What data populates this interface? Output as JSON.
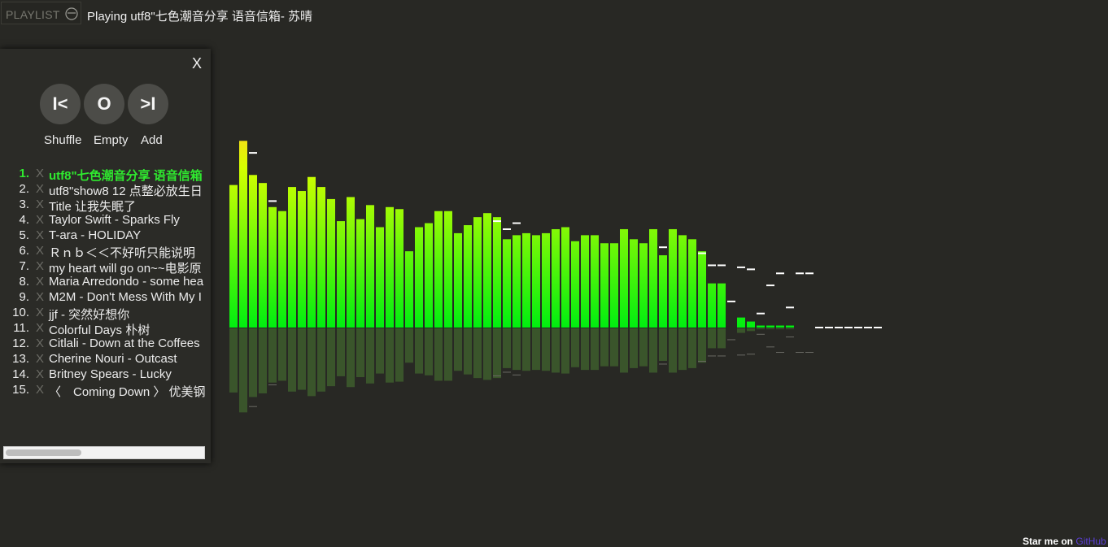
{
  "header": {
    "playlist_label": "PLAYLIST",
    "now_playing": "Playing utf8\"七色潮音分享 语音信箱- 苏晴"
  },
  "panel": {
    "close_label": "X",
    "controls": {
      "prev_symbol": "I<",
      "stop_symbol": "O",
      "next_symbol": ">I",
      "shuffle_label": "Shuffle",
      "empty_label": "Empty",
      "add_label": "Add"
    },
    "remove_symbol": "X",
    "tracks": [
      {
        "num": "1.",
        "title": "utf8\"七色潮音分享 语音信箱",
        "active": true
      },
      {
        "num": "2.",
        "title": "utf8\"show8 12 点整必放生日"
      },
      {
        "num": "3.",
        "title": "Title 让我失眠了"
      },
      {
        "num": "4.",
        "title": "Taylor Swift - Sparks Fly"
      },
      {
        "num": "5.",
        "title": "T-ara - HOLIDAY"
      },
      {
        "num": "6.",
        "title": "Ｒｎｂ＜＜不好听只能说明"
      },
      {
        "num": "7.",
        "title": "my heart will go on~~电影原"
      },
      {
        "num": "8.",
        "title": "Maria Arredondo - some hea"
      },
      {
        "num": "9.",
        "title": "M2M - Don't Mess With My I"
      },
      {
        "num": "10.",
        "title": "jjf - 突然好想你"
      },
      {
        "num": "11.",
        "title": "Colorful Days 朴树"
      },
      {
        "num": "12.",
        "title": "Citlali - Down at the Coffees"
      },
      {
        "num": "13.",
        "title": "Cherine Nouri - Outcast"
      },
      {
        "num": "14.",
        "title": "Britney Spears - Lucky"
      },
      {
        "num": "15.",
        "title": "〈　Coming Down 〉 优美钢"
      }
    ]
  },
  "visualizer": {
    "colors": {
      "top": "#ffd21e",
      "mid": "#d6ff00",
      "bottom": "#00ee10",
      "cap": "#ffffff",
      "reflection": "#3c5a2c"
    },
    "bar_levels": [
      0.71,
      0.93,
      0.76,
      0.72,
      0.6,
      0.58,
      0.7,
      0.68,
      0.75,
      0.7,
      0.64,
      0.53,
      0.65,
      0.54,
      0.61,
      0.5,
      0.6,
      0.59,
      0.38,
      0.5,
      0.52,
      0.58,
      0.58,
      0.47,
      0.51,
      0.55,
      0.57,
      0.55,
      0.44,
      0.46,
      0.47,
      0.46,
      0.47,
      0.49,
      0.5,
      0.43,
      0.46,
      0.46,
      0.42,
      0.42,
      0.49,
      0.44,
      0.42,
      0.49,
      0.36,
      0.49,
      0.46,
      0.44,
      0.38,
      0.22,
      0.22,
      0.0,
      0.05,
      0.03,
      0.01,
      0.01,
      0.01,
      0.01,
      0.0,
      0.0,
      0.0,
      0.0,
      0.0,
      0.0,
      0.0,
      0.0,
      0.0
    ],
    "peak_levels": [
      null,
      null,
      0.87,
      null,
      0.63,
      null,
      null,
      null,
      null,
      null,
      null,
      null,
      null,
      null,
      null,
      null,
      null,
      null,
      null,
      null,
      null,
      null,
      null,
      null,
      null,
      null,
      null,
      0.53,
      0.49,
      0.52,
      null,
      null,
      null,
      null,
      null,
      null,
      null,
      null,
      null,
      null,
      null,
      null,
      null,
      null,
      0.4,
      null,
      null,
      null,
      0.37,
      0.31,
      0.31,
      0.13,
      0.3,
      0.29,
      0.07,
      0.21,
      0.27,
      0.1,
      0.27,
      0.27,
      0.0,
      0.0,
      0.0,
      0.0,
      0.0,
      0.0,
      0.0
    ]
  },
  "footer": {
    "prefix": "Star me on ",
    "link": "GitHub"
  }
}
